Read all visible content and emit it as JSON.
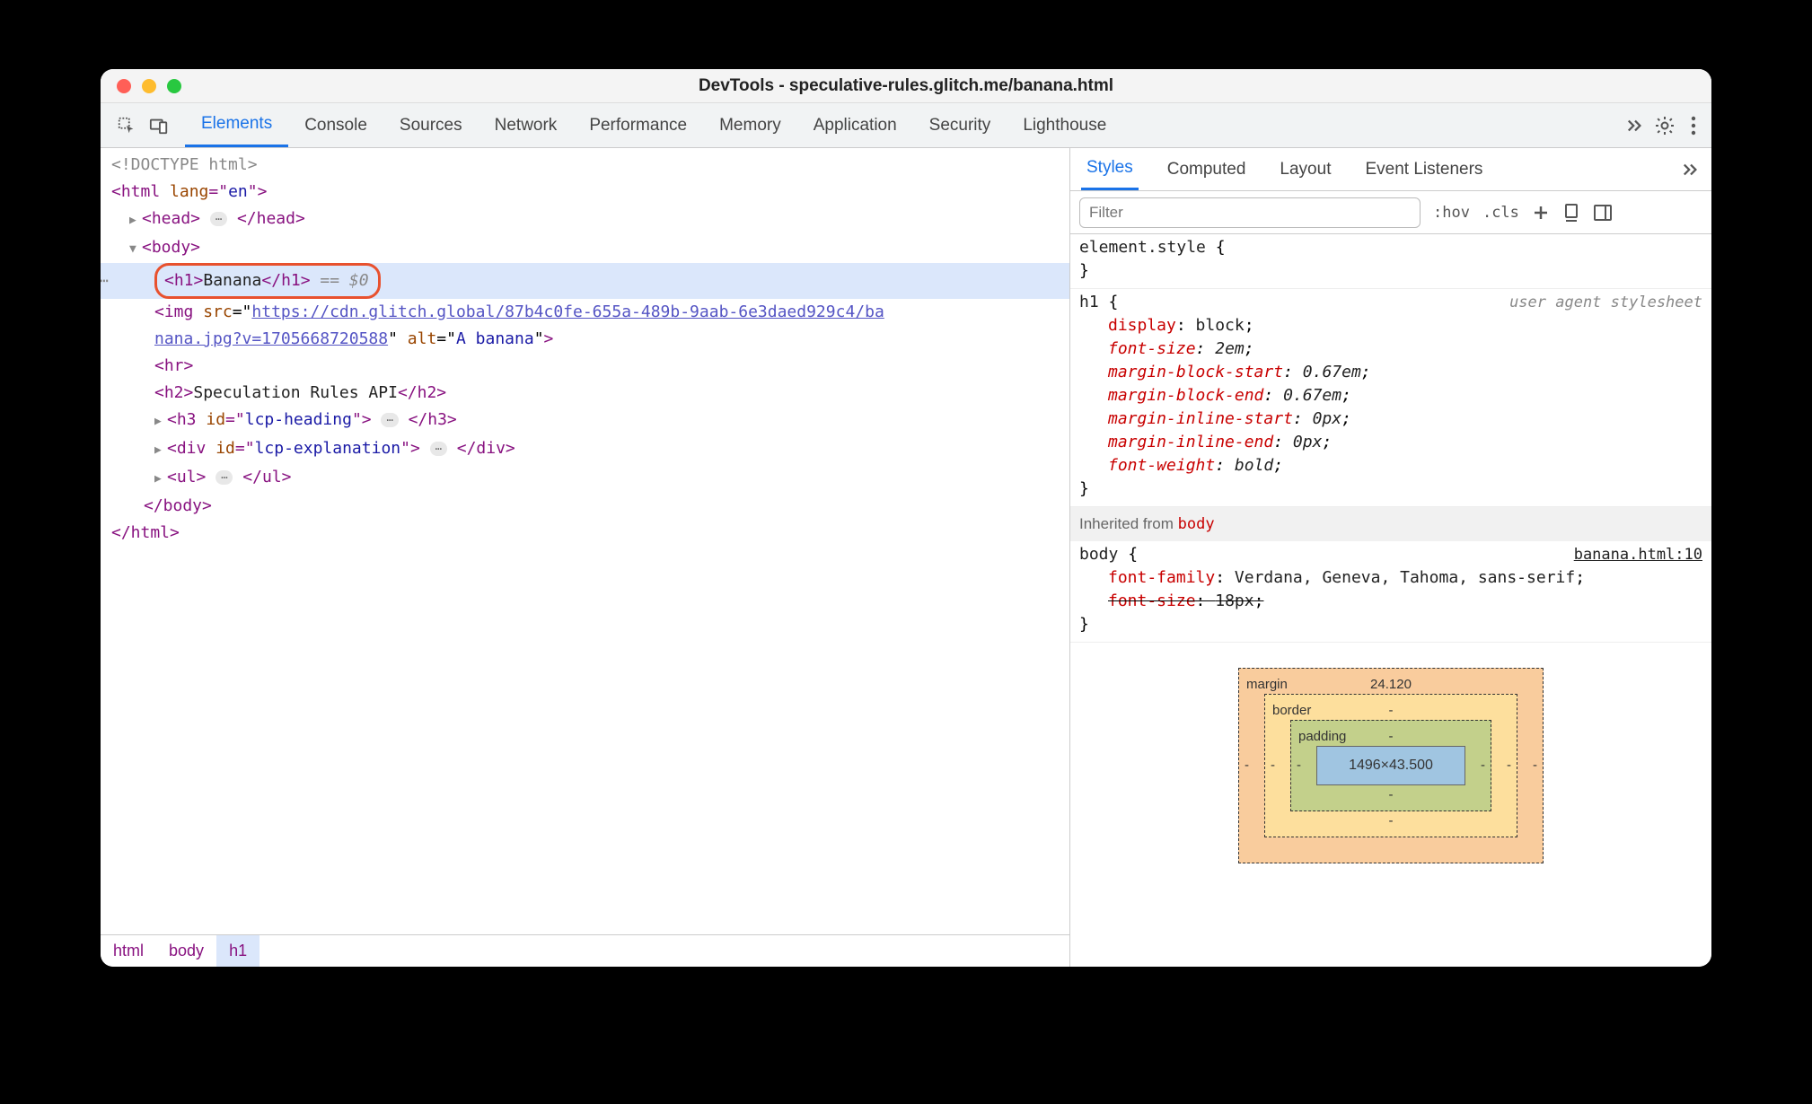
{
  "window": {
    "title": "DevTools - speculative-rules.glitch.me/banana.html"
  },
  "mainTabs": [
    "Elements",
    "Console",
    "Sources",
    "Network",
    "Performance",
    "Memory",
    "Application",
    "Security",
    "Lighthouse"
  ],
  "mainTabsActive": 0,
  "dom": {
    "doctype": "<!DOCTYPE html>",
    "htmlOpen": "<html lang=\"en\">",
    "headCollapsed": "<head>…</head>",
    "bodyOpen": "<body>",
    "h1_tagOpen": "<h1>",
    "h1_text": "Banana",
    "h1_tagClose": "</h1>",
    "h1_suffix": " == $0",
    "img_prefix": "<img src=\"",
    "img_url1": "https://cdn.glitch.global/87b4c0fe-655a-489b-9aab-6e3daed929c4/ba",
    "img_url2": "nana.jpg?v=1705668720588",
    "img_suffix": "\" alt=\"A banana\">",
    "hr": "<hr>",
    "h2_open": "<h2>",
    "h2_text": "Speculation Rules API",
    "h2_close": "</h2>",
    "h3": "<h3 id=\"lcp-heading\">…</h3>",
    "div": "<div id=\"lcp-explanation\">…</div>",
    "ul": "<ul>…</ul>",
    "bodyClose": "</body>",
    "htmlClose": "</html>"
  },
  "breadcrumbs": [
    "html",
    "body",
    "h1"
  ],
  "subTabs": [
    "Styles",
    "Computed",
    "Layout",
    "Event Listeners"
  ],
  "subTabsActive": 0,
  "filterPlaceholder": "Filter",
  "filterButtons": {
    "hov": ":hov",
    "cls": ".cls"
  },
  "styles": {
    "elementStyle": {
      "selector": "element.style",
      "props": []
    },
    "h1": {
      "selector": "h1",
      "note": "user agent stylesheet",
      "props": [
        {
          "n": "display",
          "v": "block"
        },
        {
          "n": "font-size",
          "v": "2em",
          "italic": true
        },
        {
          "n": "margin-block-start",
          "v": "0.67em",
          "italic": true
        },
        {
          "n": "margin-block-end",
          "v": "0.67em",
          "italic": true
        },
        {
          "n": "margin-inline-start",
          "v": "0px",
          "italic": true
        },
        {
          "n": "margin-inline-end",
          "v": "0px",
          "italic": true
        },
        {
          "n": "font-weight",
          "v": "bold",
          "italic": true
        }
      ]
    },
    "inheritedFrom": "Inherited from",
    "inheritedSel": "body",
    "body": {
      "selector": "body",
      "src": "banana.html:10",
      "props": [
        {
          "n": "font-family",
          "v": "Verdana, Geneva, Tahoma, sans-serif"
        },
        {
          "n": "font-size",
          "v": "18px",
          "strike": true
        }
      ]
    }
  },
  "boxModel": {
    "marginLabel": "margin",
    "marginTop": "24.120",
    "borderLabel": "border",
    "paddingLabel": "padding",
    "content": "1496×43.500",
    "dash": "-"
  }
}
